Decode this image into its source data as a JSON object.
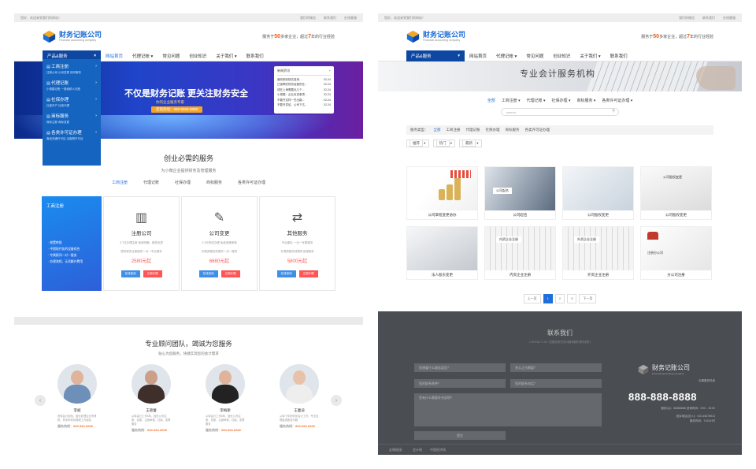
{
  "site": {
    "topbar_welcome": "您好，欢迎来到我们的网站！",
    "topbar_links": [
      "我们的微信",
      "联系我们",
      "在线客服"
    ],
    "logo_name": "财务记账公司",
    "logo_sub": "Financial accounting company",
    "slogan_prefix": "服务于",
    "slogan_num1": "50",
    "slogan_mid": "多家企业，超过",
    "slogan_num2": "7",
    "slogan_suffix": "年的行业经验",
    "product_menu": "产品&服务",
    "nav_left": [
      "网站首页",
      "代理记帐",
      "常见问题",
      "创业知识",
      "关于我们",
      "联系我们"
    ],
    "nav_right": [
      "网站首页",
      "代理记帐",
      "常见问题",
      "创业知识",
      "关于我们",
      "联系我们"
    ]
  },
  "left": {
    "banner_title": "不仅是财务记账 更关注财务安全",
    "banner_sub": "你的企业服务专家",
    "banner_hotline": "咨询热线：888-6666-8888",
    "news_title": "新闻资讯",
    "news_more": "+",
    "news": [
      {
        "t": "营收税收核实费用...",
        "d": "02-24"
      },
      {
        "t": "已保障的财务经营所在...",
        "d": "02-24"
      },
      {
        "t": "成在上海需要出几个...",
        "d": "02-24"
      },
      {
        "t": "小规模：企业负担事项...",
        "d": "02-24"
      },
      {
        "t": "不要开这样一些出路...",
        "d": "02-24"
      },
      {
        "t": "不要开发给，公司下达...",
        "d": "02-24"
      }
    ],
    "dropdown": [
      {
        "title": "工商注册",
        "sub": "注册公司  公司变更  刻印服务"
      },
      {
        "title": "代理记账",
        "sub": "小规模记账  一般纳税人记账"
      },
      {
        "title": "社保办理",
        "sub": "社保开户  社保代理"
      },
      {
        "title": "商标服务",
        "sub": "商标注册  商标变更"
      },
      {
        "title": "各类许可证办理",
        "sub": "食品流通许可证  出版物许可证"
      }
    ],
    "sec_title": "创业必需的服务",
    "sec_sub": "为小微企业提供财务及管理服务",
    "tabs": [
      "工商注册",
      "代理记账",
      "社保办理",
      "商标服务",
      "各类许可证办理"
    ],
    "card_side_title": "工商注册",
    "card_side_lines": [
      "· 前置审批",
      "· 中国现代化的设备综合",
      "· 专属顾问一对一服务",
      "· 办理流程，无须额外费用"
    ],
    "cards": [
      {
        "icon": "building-icon",
        "title": "注册公司",
        "d1": "3-7日办理注册 费用明确，服务优质",
        "d2": "提供税务注册服务一对一专业服务",
        "price": "2580元起",
        "b1": "在线咨询",
        "b2": "立即办理"
      },
      {
        "icon": "edit-icon",
        "title": "公司变更",
        "d1": "2-3日完成办理 免费资格审核",
        "d2": "办理资格完成提供一对一服务",
        "price": "6680元起",
        "b1": "在线咨询",
        "b2": "立即办理"
      },
      {
        "icon": "exchange-icon",
        "title": "其他服务",
        "d1": "专业团队 一对一专属服务",
        "d2": "办理资格完成提供全程服务",
        "price": "5800元起",
        "b1": "在线咨询",
        "b2": "立即办理"
      }
    ],
    "team_title": "专业顾问团队，竭诚为您服务",
    "team_sub": "贴心为您服务，快捷实现您的会计需求",
    "team": [
      {
        "name": "李斌",
        "desc": "资深会计经验，擅长处理企业所得税，有多年财务管理工作经验",
        "phone_label": "服务热线：",
        "phone": "888-888-8888"
      },
      {
        "name": "王艳蕾",
        "desc": "从事会计工作8年，擅长公司注册、变更、注销审核、社保、发票服务",
        "phone_label": "服务热线：",
        "phone": "888-888-8888"
      },
      {
        "name": "李梅斯",
        "desc": "从事会计工作8年，擅长公司注册、变更、注销审核、社保、发票服务",
        "phone_label": "服务热线：",
        "phone": "888-888-8888"
      },
      {
        "name": "王蕾迪",
        "desc": "从事十年的财务会计工作，专业处理各类账务问题",
        "phone_label": "服务热线：",
        "phone": "888-888-8888"
      }
    ]
  },
  "right": {
    "banner_title": "专业会计服务机构",
    "filter_nav": [
      "全部",
      "工商注册",
      "代理记账",
      "社保办理",
      "商标服务",
      "各类许可证办理"
    ],
    "search_placeholder": "search",
    "filter_label": "服务类型：",
    "filter_items": [
      "全部",
      "工商注册",
      "代理记账",
      "社保办理",
      "商标服务",
      "各类许可证办理"
    ],
    "sorts": [
      "推荐",
      "热门",
      "最新"
    ],
    "items": [
      "公司章程变更协办",
      "公司起名",
      "公司股权变更",
      "公司股权变更",
      "法人股东变更",
      "内资企业注册",
      "外资企业注册",
      "分公司注册"
    ],
    "pager": [
      "上一页",
      "1",
      "2",
      "3",
      "下一页"
    ],
    "contact_title": "联系我们",
    "contact_sub": "CONTACT US / 如果您有任何问题请随时联系我们",
    "fields": [
      "您想要什么服务类型？",
      "多久之内需要？",
      "您的联系称呼？",
      "您的联系电话？",
      "您有什么需要补充说明？"
    ],
    "submit": "提交",
    "brand_name": "财务记账公司",
    "brand_sub": "Financial accounting company",
    "hotline_label": "长期服务热线",
    "tel": "888-888-8888",
    "info": [
      "服务QQ：66888888  咨询时间：9:00 - 18:00",
      "投诉电话(法人)：010-45678910",
      "服务时间：7x24小时"
    ],
    "footer_links": [
      "友情链接：",
      "会计网",
      "中国经济网"
    ]
  }
}
